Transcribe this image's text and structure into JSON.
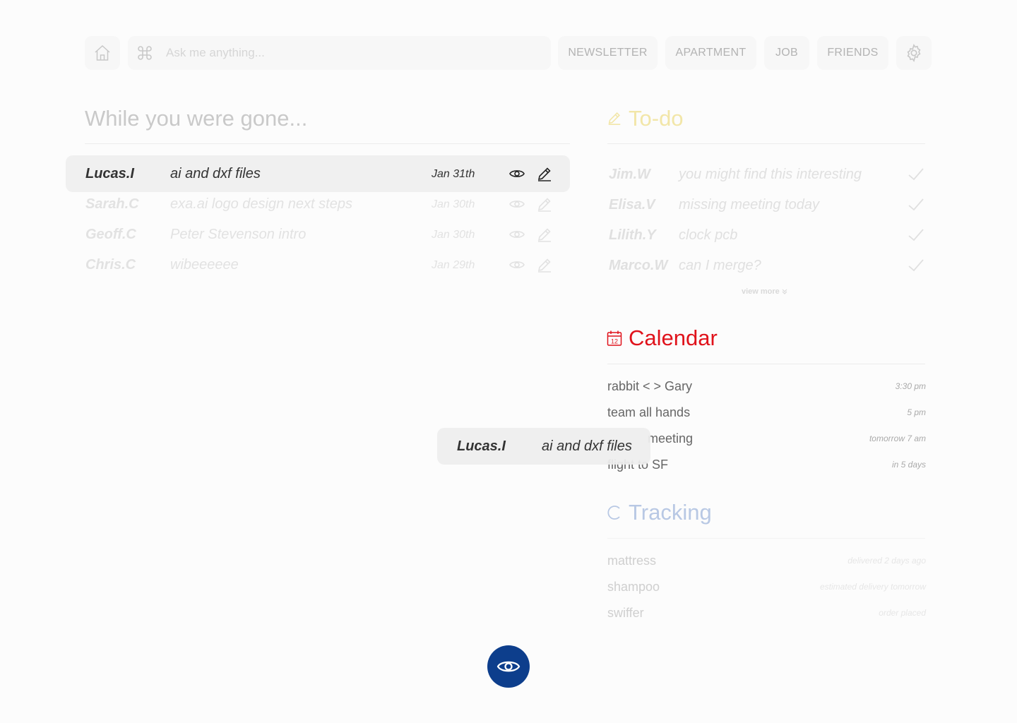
{
  "search": {
    "placeholder": "Ask me anything..."
  },
  "nav": {
    "tabs": [
      "NEWSLETTER",
      "APARTMENT",
      "JOB",
      "FRIENDS"
    ]
  },
  "inbox": {
    "title": "While you were gone...",
    "messages": [
      {
        "from": "Lucas.I",
        "subject": "ai and dxf files",
        "date": "Jan 31th"
      },
      {
        "from": "Sarah.C",
        "subject": "exa.ai logo design next steps",
        "date": "Jan 30th"
      },
      {
        "from": "Geoff.C",
        "subject": "Peter Stevenson intro",
        "date": "Jan 30th"
      },
      {
        "from": "Chris.C",
        "subject": "wibeeeeee",
        "date": "Jan 29th"
      }
    ]
  },
  "todo": {
    "title": "To-do",
    "items": [
      {
        "from": "Jim.W",
        "subject": "you might find this interesting"
      },
      {
        "from": "Elisa.V",
        "subject": "missing meeting today"
      },
      {
        "from": "Lilith.Y",
        "subject": "clock pcb"
      },
      {
        "from": "Marco.W",
        "subject": "can I merge?"
      }
    ],
    "view_more": "view more"
  },
  "calendar": {
    "title": "Calendar",
    "icon_day": "12",
    "events": [
      {
        "name": "rabbit < > Gary",
        "time": "3:30 pm"
      },
      {
        "name": "team all hands",
        "time": "5 pm"
      },
      {
        "name": "meeting",
        "time": "tomorrow 7 am"
      },
      {
        "name": "flight to SF",
        "time": "in 5 days"
      }
    ]
  },
  "tracking": {
    "title": "Tracking",
    "items": [
      {
        "name": "mattress",
        "status": "delivered 2 days ago"
      },
      {
        "name": "shampoo",
        "status": "estimated delivery tomorrow"
      },
      {
        "name": "swiffer",
        "status": "order placed"
      }
    ]
  },
  "drag_ghost": {
    "from": "Lucas.I",
    "subject": "ai and dxf files"
  },
  "colors": {
    "todo_accent": "#f2e6a8",
    "calendar_accent": "#e0121b",
    "tracking_accent": "#b8c8e4",
    "fab": "#0d3e8c"
  },
  "icons": [
    "home-icon",
    "command-icon",
    "gear-icon",
    "eye-icon",
    "pencil-icon",
    "check-icon",
    "calendar-icon",
    "tracking-icon",
    "chevron-down-icon"
  ]
}
